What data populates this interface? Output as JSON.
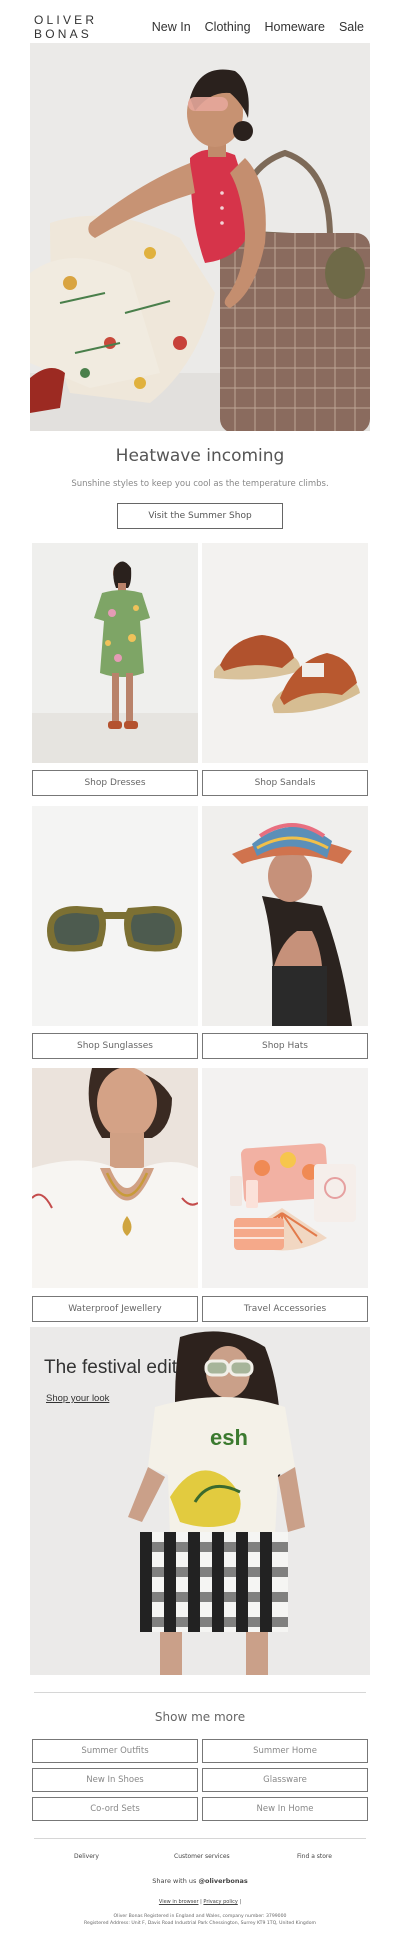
{
  "header": {
    "logo": "OLIVER BONAS",
    "nav": [
      "New In",
      "Clothing",
      "Homeware",
      "Sale"
    ]
  },
  "hero": {
    "heading": "Heatwave incoming",
    "subheading": "Sunshine styles to keep you cool as the temperature climbs.",
    "cta": "Visit the Summer Shop"
  },
  "tiles": [
    {
      "label": "Shop Dresses"
    },
    {
      "label": "Shop Sandals"
    },
    {
      "label": "Shop Sunglasses"
    },
    {
      "label": "Shop Hats"
    },
    {
      "label": "Waterproof Jewellery"
    },
    {
      "label": "Travel Accessories"
    }
  ],
  "festival": {
    "title": "The festival edit",
    "link": "Shop your look"
  },
  "more": {
    "title": "Show me more",
    "buttons": [
      "Summer Outfits",
      "Summer Home",
      "New In Shoes",
      "Glassware",
      "Co-ord Sets",
      "New In Home"
    ]
  },
  "footer": {
    "links": [
      "Delivery",
      "Customer services",
      "Find a store"
    ],
    "share_prefix": "Share with us",
    "share_handle": "@oliverbonas",
    "view_in_browser": "View in browser",
    "privacy": "Privacy policy",
    "legal_line1": "Oliver Bonas Registered in England and Wales, company number: 3799000",
    "legal_line2": "Registered Address: Unit F, Davis Road Industrial Park Chessington, Surrey KT9 1TQ, United Kingdom"
  }
}
